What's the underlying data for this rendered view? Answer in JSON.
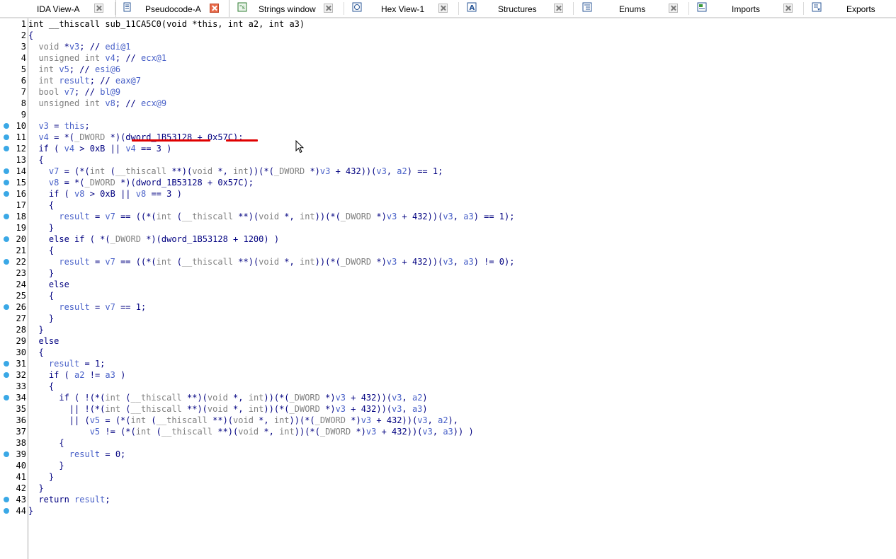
{
  "tabs": [
    {
      "label": "IDA View-A",
      "icon": "graph-icon",
      "active": false
    },
    {
      "label": "Pseudocode-A",
      "icon": "document-icon",
      "active": true
    },
    {
      "label": "Strings window",
      "icon": "strings-icon",
      "active": false
    },
    {
      "label": "Hex View-1",
      "icon": "hex-icon",
      "active": false
    },
    {
      "label": "Structures",
      "icon": "structures-icon",
      "active": false
    },
    {
      "label": "Enums",
      "icon": "enums-icon",
      "active": false
    },
    {
      "label": "Imports",
      "icon": "imports-icon",
      "active": false
    },
    {
      "label": "Exports",
      "icon": "exports-icon",
      "active": false
    }
  ],
  "code": {
    "lines": [
      "int __thiscall sub_11CA5C0(void *this, int a2, int a3)",
      "{",
      "  void *v3; // edi@1",
      "  unsigned int v4; // ecx@1",
      "  int v5; // esi@6",
      "  int result; // eax@7",
      "  bool v7; // bl@9",
      "  unsigned int v8; // ecx@9",
      "",
      "  v3 = this;",
      "  v4 = *(_DWORD *)(dword_1B53128 + 0x57C);",
      "  if ( v4 > 0xB || v4 == 3 )",
      "  {",
      "    v7 = (*(int (__thiscall **)(void *, int))(*(_DWORD *)v3 + 432))(v3, a2) == 1;",
      "    v8 = *(_DWORD *)(dword_1B53128 + 0x57C);",
      "    if ( v8 > 0xB || v8 == 3 )",
      "    {",
      "      result = v7 == ((*(int (__thiscall **)(void *, int))(*(_DWORD *)v3 + 432))(v3, a3) == 1);",
      "    }",
      "    else if ( *(_DWORD *)(dword_1B53128 + 1200) )",
      "    {",
      "      result = v7 == ((*(int (__thiscall **)(void *, int))(*(_DWORD *)v3 + 432))(v3, a3) != 0);",
      "    }",
      "    else",
      "    {",
      "      result = v7 == 1;",
      "    }",
      "  }",
      "  else",
      "  {",
      "    result = 1;",
      "    if ( a2 != a3 )",
      "    {",
      "      if ( !(*(int (__thiscall **)(void *, int))(*(_DWORD *)v3 + 432))(v3, a2)",
      "        || !(*(int (__thiscall **)(void *, int))(*(_DWORD *)v3 + 432))(v3, a3)",
      "        || (v5 = (*(int (__thiscall **)(void *, int))(*(_DWORD *)v3 + 432))(v3, a2),",
      "            v5 != (*(int (__thiscall **)(void *, int))(*(_DWORD *)v3 + 432))(v3, a3)) )",
      "      {",
      "        result = 0;",
      "      }",
      "    }",
      "  }",
      "  return result;",
      "}"
    ],
    "breakpoint_lines": [
      10,
      11,
      12,
      14,
      15,
      16,
      18,
      20,
      22,
      26,
      31,
      32,
      34,
      39,
      43,
      44
    ]
  },
  "colors": {
    "keyword": "#000080",
    "variable": "#4860c8",
    "breakpoint": "#3aa8e6",
    "annotation_underline": "#e00000",
    "active_close": "#e86a4a"
  }
}
